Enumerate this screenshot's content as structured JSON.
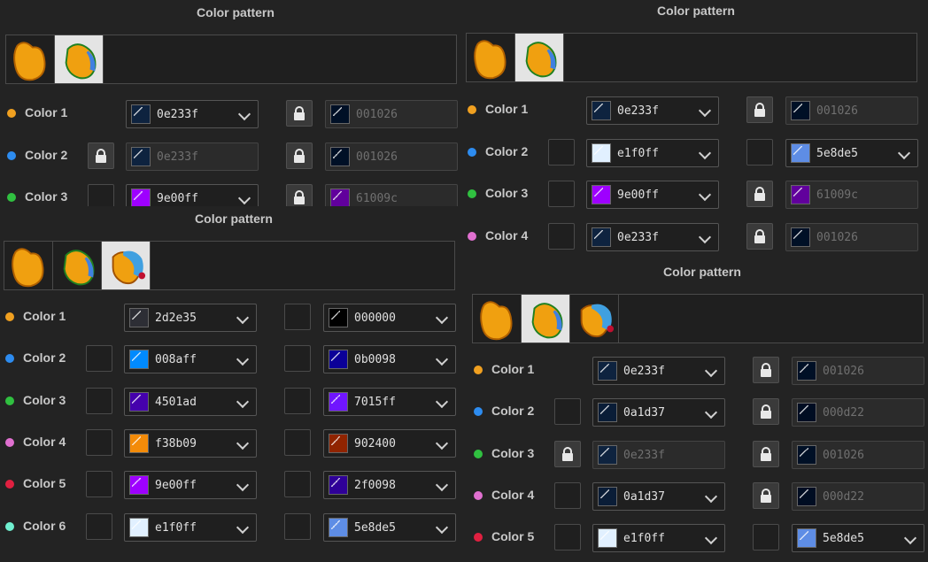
{
  "panels": [
    {
      "title": "Color pattern",
      "thumbs": 2,
      "selected": 1,
      "rows": [
        {
          "label": "Color 1",
          "dot": "#f0a020",
          "lock1": null,
          "c1": "#0e233f",
          "hex1": "0e233f",
          "dis1": false,
          "lock2": true,
          "c2": "#001026",
          "hex2": "001026",
          "dis2": true
        },
        {
          "label": "Color 2",
          "dot": "#2d8cf0",
          "lock1": true,
          "c1": "#0e233f",
          "hex1": "0e233f",
          "dis1": true,
          "lock2": true,
          "c2": "#001026",
          "hex2": "001026",
          "dis2": true
        },
        {
          "label": "Color 3",
          "dot": "#30c040",
          "lock1": false,
          "c1": "#9e00ff",
          "hex1": "9e00ff",
          "dis1": false,
          "lock2": true,
          "c2": "#61009c",
          "hex2": "61009c",
          "dis2": true
        }
      ]
    },
    {
      "title": "Color pattern",
      "thumbs": 2,
      "selected": 1,
      "rows": [
        {
          "label": "Color 1",
          "dot": "#f0a020",
          "lock1": null,
          "c1": "#0e233f",
          "hex1": "0e233f",
          "dis1": false,
          "lock2": true,
          "c2": "#001026",
          "hex2": "001026",
          "dis2": true
        },
        {
          "label": "Color 2",
          "dot": "#2d8cf0",
          "lock1": false,
          "c1": "#e1f0ff",
          "hex1": "e1f0ff",
          "dis1": false,
          "lock2": false,
          "c2": "#5e8de5",
          "hex2": "5e8de5",
          "dis2": false
        },
        {
          "label": "Color 3",
          "dot": "#30c040",
          "lock1": false,
          "c1": "#9e00ff",
          "hex1": "9e00ff",
          "dis1": false,
          "lock2": true,
          "c2": "#61009c",
          "hex2": "61009c",
          "dis2": true
        },
        {
          "label": "Color 4",
          "dot": "#e070d0",
          "lock1": false,
          "c1": "#0e233f",
          "hex1": "0e233f",
          "dis1": false,
          "lock2": true,
          "c2": "#001026",
          "hex2": "001026",
          "dis2": true
        }
      ]
    },
    {
      "title": "Color pattern",
      "thumbs": 3,
      "selected": 2,
      "rows": [
        {
          "label": "Color 1",
          "dot": "#f0a020",
          "lock1": null,
          "c1": "#2d2e35",
          "hex1": "2d2e35",
          "dis1": false,
          "lock2": false,
          "c2": "#000000",
          "hex2": "000000",
          "dis2": false
        },
        {
          "label": "Color 2",
          "dot": "#2d8cf0",
          "lock1": false,
          "c1": "#008aff",
          "hex1": "008aff",
          "dis1": false,
          "lock2": false,
          "c2": "#0b0098",
          "hex2": "0b0098",
          "dis2": false
        },
        {
          "label": "Color 3",
          "dot": "#30c040",
          "lock1": false,
          "c1": "#4501ad",
          "hex1": "4501ad",
          "dis1": false,
          "lock2": false,
          "c2": "#7015ff",
          "hex2": "7015ff",
          "dis2": false
        },
        {
          "label": "Color 4",
          "dot": "#e070d0",
          "lock1": false,
          "c1": "#f38b09",
          "hex1": "f38b09",
          "dis1": false,
          "lock2": false,
          "c2": "#902400",
          "hex2": "902400",
          "dis2": false
        },
        {
          "label": "Color 5",
          "dot": "#e02040",
          "lock1": false,
          "c1": "#9e00ff",
          "hex1": "9e00ff",
          "dis1": false,
          "lock2": false,
          "c2": "#2f0098",
          "hex2": "2f0098",
          "dis2": false
        },
        {
          "label": "Color 6",
          "dot": "#70f0d0",
          "lock1": false,
          "c1": "#e1f0ff",
          "hex1": "e1f0ff",
          "dis1": false,
          "lock2": false,
          "c2": "#5e8de5",
          "hex2": "5e8de5",
          "dis2": false
        }
      ]
    },
    {
      "title": "Color pattern",
      "thumbs": 3,
      "selected": 1,
      "rows": [
        {
          "label": "Color 1",
          "dot": "#f0a020",
          "lock1": null,
          "c1": "#0e233f",
          "hex1": "0e233f",
          "dis1": false,
          "lock2": true,
          "c2": "#001026",
          "hex2": "001026",
          "dis2": true
        },
        {
          "label": "Color 2",
          "dot": "#2d8cf0",
          "lock1": false,
          "c1": "#0a1d37",
          "hex1": "0a1d37",
          "dis1": false,
          "lock2": true,
          "c2": "#000d22",
          "hex2": "000d22",
          "dis2": true
        },
        {
          "label": "Color 3",
          "dot": "#30c040",
          "lock1": true,
          "c1": "#0e233f",
          "hex1": "0e233f",
          "dis1": true,
          "lock2": true,
          "c2": "#001026",
          "hex2": "001026",
          "dis2": true
        },
        {
          "label": "Color 4",
          "dot": "#e070d0",
          "lock1": false,
          "c1": "#0a1d37",
          "hex1": "0a1d37",
          "dis1": false,
          "lock2": true,
          "c2": "#000d22",
          "hex2": "000d22",
          "dis2": true
        },
        {
          "label": "Color 5",
          "dot": "#e02040",
          "lock1": false,
          "c1": "#e1f0ff",
          "hex1": "e1f0ff",
          "dis1": false,
          "lock2": false,
          "c2": "#5e8de5",
          "hex2": "5e8de5",
          "dis2": false
        }
      ]
    }
  ]
}
